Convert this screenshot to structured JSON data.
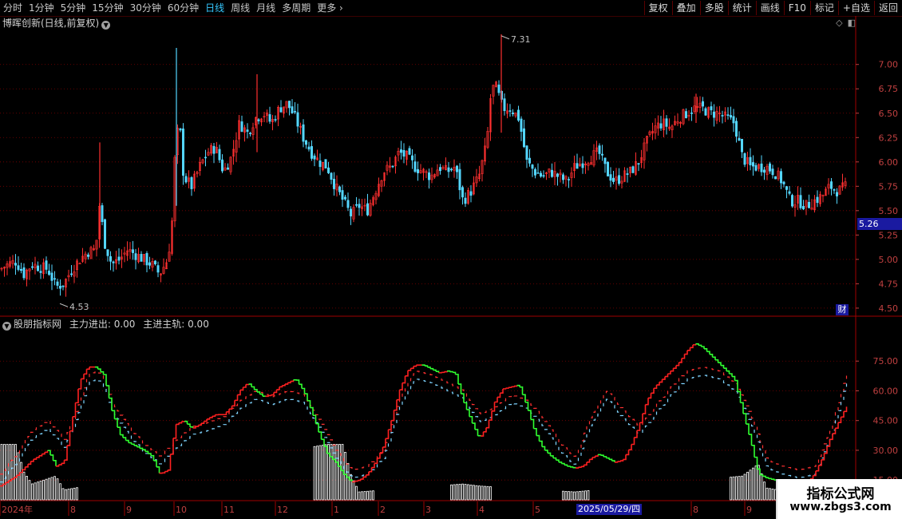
{
  "toolbar": {
    "periods": [
      "分时",
      "1分钟",
      "5分钟",
      "15分钟",
      "30分钟",
      "60分钟",
      "日线",
      "周线",
      "月线",
      "多周期",
      "更多"
    ],
    "active_period": "日线",
    "right_buttons": [
      "复权",
      "叠加",
      "多股",
      "统计",
      "画线",
      "F10",
      "标记",
      "+自选",
      "返回"
    ]
  },
  "main_panel": {
    "title": "博晖创新(日线,前复权)",
    "current_price": "5.26",
    "finance_badge": "财",
    "high_label": "7.31",
    "low_label": "4.53"
  },
  "sub_panel": {
    "title": "股朋指标网",
    "indicator1": "主力进出: 0.00",
    "indicator2": "主进主轨: 0.00"
  },
  "x_axis": {
    "labels": [
      "2024年",
      "8",
      "9",
      "10",
      "11",
      "12",
      "1",
      "2",
      "3",
      "4",
      "5",
      "2025/05/29/四",
      "8",
      "9"
    ]
  },
  "watermark": {
    "line1": "指标公式网",
    "line2": "www.zbgs3.com"
  },
  "colors": {
    "up": "#ff3030",
    "down": "#54d6ff",
    "grid": "#800000",
    "axis": "#c04040",
    "green_line": "#30ff30",
    "red_line": "#ff2020",
    "blue_line": "#7fd4ff"
  },
  "chart_data": [
    {
      "type": "candlestick",
      "title": "博晖创新(日线,前复权)",
      "y_ticks": [
        7.0,
        6.75,
        6.5,
        6.25,
        6.0,
        5.75,
        5.5,
        5.25,
        5.0,
        4.75,
        4.5
      ],
      "ylim": [
        4.45,
        7.35
      ],
      "max": 7.31,
      "min": 4.53,
      "last": 5.26,
      "approx_close_path": [
        [
          0,
          4.9
        ],
        [
          10,
          4.95
        ],
        [
          20,
          4.98
        ],
        [
          30,
          4.85
        ],
        [
          40,
          4.95
        ],
        [
          50,
          4.92
        ],
        [
          60,
          4.9
        ],
        [
          70,
          4.72
        ],
        [
          80,
          4.75
        ],
        [
          90,
          4.9
        ],
        [
          100,
          5.0
        ],
        [
          110,
          5.08
        ],
        [
          120,
          5.1
        ],
        [
          125,
          5.6
        ],
        [
          130,
          5.2
        ],
        [
          140,
          4.95
        ],
        [
          150,
          5.0
        ],
        [
          160,
          5.1
        ],
        [
          170,
          5.05
        ],
        [
          180,
          5.0
        ],
        [
          190,
          4.95
        ],
        [
          200,
          4.85
        ],
        [
          210,
          5.0
        ],
        [
          215,
          5.3
        ],
        [
          220,
          6.2
        ],
        [
          225,
          6.4
        ],
        [
          230,
          5.85
        ],
        [
          240,
          5.75
        ],
        [
          250,
          5.95
        ],
        [
          260,
          6.1
        ],
        [
          270,
          6.15
        ],
        [
          280,
          5.9
        ],
        [
          290,
          6.05
        ],
        [
          300,
          6.4
        ],
        [
          310,
          6.3
        ],
        [
          320,
          6.45
        ],
        [
          330,
          6.5
        ],
        [
          340,
          6.4
        ],
        [
          350,
          6.55
        ],
        [
          360,
          6.6
        ],
        [
          370,
          6.45
        ],
        [
          380,
          6.25
        ],
        [
          390,
          6.1
        ],
        [
          400,
          6.0
        ],
        [
          410,
          5.95
        ],
        [
          420,
          5.75
        ],
        [
          430,
          5.6
        ],
        [
          440,
          5.45
        ],
        [
          450,
          5.55
        ],
        [
          460,
          5.5
        ],
        [
          470,
          5.7
        ],
        [
          480,
          5.9
        ],
        [
          490,
          5.95
        ],
        [
          500,
          6.1
        ],
        [
          510,
          6.05
        ],
        [
          520,
          5.95
        ],
        [
          530,
          5.9
        ],
        [
          540,
          5.85
        ],
        [
          550,
          5.95
        ],
        [
          560,
          5.9
        ],
        [
          570,
          5.95
        ],
        [
          580,
          5.6
        ],
        [
          590,
          5.7
        ],
        [
          600,
          5.85
        ],
        [
          610,
          6.2
        ],
        [
          615,
          6.7
        ],
        [
          620,
          6.8
        ],
        [
          630,
          6.55
        ],
        [
          640,
          6.55
        ],
        [
          650,
          6.45
        ],
        [
          660,
          6.0
        ],
        [
          670,
          5.9
        ],
        [
          680,
          5.85
        ],
        [
          690,
          5.9
        ],
        [
          700,
          5.85
        ],
        [
          710,
          5.8
        ],
        [
          720,
          5.95
        ],
        [
          730,
          6.0
        ],
        [
          740,
          6.05
        ],
        [
          750,
          6.1
        ],
        [
          760,
          5.9
        ],
        [
          770,
          5.8
        ],
        [
          780,
          5.85
        ],
        [
          790,
          5.9
        ],
        [
          800,
          6.0
        ],
        [
          810,
          6.2
        ],
        [
          820,
          6.35
        ],
        [
          830,
          6.4
        ],
        [
          840,
          6.35
        ],
        [
          850,
          6.45
        ],
        [
          860,
          6.5
        ],
        [
          870,
          6.55
        ],
        [
          880,
          6.55
        ],
        [
          890,
          6.5
        ],
        [
          900,
          6.5
        ],
        [
          910,
          6.45
        ],
        [
          920,
          6.4
        ],
        [
          930,
          6.05
        ],
        [
          940,
          5.95
        ],
        [
          950,
          5.95
        ],
        [
          960,
          5.95
        ],
        [
          970,
          5.9
        ],
        [
          980,
          5.8
        ],
        [
          990,
          5.6
        ],
        [
          1000,
          5.6
        ],
        [
          1010,
          5.55
        ],
        [
          1020,
          5.6
        ],
        [
          1030,
          5.65
        ],
        [
          1040,
          5.75
        ],
        [
          1050,
          5.7
        ],
        [
          1060,
          5.75
        ]
      ]
    },
    {
      "type": "line",
      "title": "股朋指标网",
      "y_ticks": [
        75.0,
        60.0,
        45.0,
        30.0,
        15.0
      ],
      "ylim": [
        5,
        90
      ],
      "series": [
        {
          "name": "主力进出",
          "values_path": [
            [
              0,
              12
            ],
            [
              20,
              17
            ],
            [
              40,
              25
            ],
            [
              60,
              30
            ],
            [
              70,
              22
            ],
            [
              80,
              24
            ],
            [
              90,
              45
            ],
            [
              100,
              65
            ],
            [
              110,
              72
            ],
            [
              120,
              72
            ],
            [
              130,
              68
            ],
            [
              140,
              50
            ],
            [
              150,
              38
            ],
            [
              160,
              34
            ],
            [
              170,
              32
            ],
            [
              180,
              30
            ],
            [
              190,
              27
            ],
            [
              200,
              18
            ],
            [
              210,
              20
            ],
            [
              220,
              43
            ],
            [
              230,
              45
            ],
            [
              240,
              41
            ],
            [
              250,
              43
            ],
            [
              260,
              46
            ],
            [
              270,
              48
            ],
            [
              280,
              48
            ],
            [
              290,
              52
            ],
            [
              300,
              60
            ],
            [
              310,
              64
            ],
            [
              320,
              60
            ],
            [
              330,
              57
            ],
            [
              340,
              58
            ],
            [
              350,
              62
            ],
            [
              360,
              64
            ],
            [
              370,
              66
            ],
            [
              380,
              60
            ],
            [
              390,
              50
            ],
            [
              400,
              38
            ],
            [
              410,
              28
            ],
            [
              420,
              24
            ],
            [
              430,
              18
            ],
            [
              440,
              14
            ],
            [
              450,
              15
            ],
            [
              460,
              18
            ],
            [
              470,
              24
            ],
            [
              480,
              32
            ],
            [
              490,
              45
            ],
            [
              500,
              60
            ],
            [
              510,
              70
            ],
            [
              520,
              73
            ],
            [
              530,
              73
            ],
            [
              540,
              71
            ],
            [
              550,
              69
            ],
            [
              560,
              70
            ],
            [
              570,
              69
            ],
            [
              580,
              55
            ],
            [
              590,
              45
            ],
            [
              600,
              36
            ],
            [
              610,
              42
            ],
            [
              620,
              55
            ],
            [
              630,
              61
            ],
            [
              640,
              62
            ],
            [
              650,
              63
            ],
            [
              660,
              52
            ],
            [
              670,
              39
            ],
            [
              680,
              31
            ],
            [
              690,
              27
            ],
            [
              700,
              24
            ],
            [
              710,
              22
            ],
            [
              720,
              21
            ],
            [
              730,
              22
            ],
            [
              740,
              26
            ],
            [
              750,
              28
            ],
            [
              760,
              26
            ],
            [
              770,
              24
            ],
            [
              780,
              25
            ],
            [
              790,
              32
            ],
            [
              800,
              42
            ],
            [
              810,
              55
            ],
            [
              820,
              62
            ],
            [
              830,
              66
            ],
            [
              840,
              70
            ],
            [
              850,
              74
            ],
            [
              860,
              80
            ],
            [
              870,
              84
            ],
            [
              880,
              82
            ],
            [
              890,
              78
            ],
            [
              900,
              74
            ],
            [
              910,
              70
            ],
            [
              920,
              66
            ],
            [
              930,
              50
            ],
            [
              940,
              35
            ],
            [
              950,
              18
            ],
            [
              960,
              16
            ],
            [
              970,
              15
            ],
            [
              980,
              14
            ],
            [
              990,
              13
            ],
            [
              1000,
              12
            ],
            [
              1010,
              13
            ],
            [
              1020,
              18
            ],
            [
              1030,
              26
            ],
            [
              1040,
              36
            ],
            [
              1050,
              44
            ],
            [
              1060,
              52
            ]
          ]
        },
        {
          "name": "主进主轨",
          "values_path": [
            [
              0,
              18
            ],
            [
              20,
              28
            ],
            [
              40,
              40
            ],
            [
              60,
              45
            ],
            [
              70,
              40
            ],
            [
              80,
              35
            ],
            [
              100,
              55
            ],
            [
              110,
              68
            ],
            [
              120,
              70
            ],
            [
              130,
              66
            ],
            [
              140,
              54
            ],
            [
              160,
              42
            ],
            [
              180,
              33
            ],
            [
              200,
              27
            ],
            [
              220,
              35
            ],
            [
              240,
              42
            ],
            [
              260,
              44
            ],
            [
              280,
              47
            ],
            [
              300,
              55
            ],
            [
              320,
              60
            ],
            [
              340,
              57
            ],
            [
              360,
              60
            ],
            [
              380,
              58
            ],
            [
              400,
              45
            ],
            [
              420,
              30
            ],
            [
              440,
              20
            ],
            [
              460,
              22
            ],
            [
              480,
              30
            ],
            [
              500,
              56
            ],
            [
              520,
              70
            ],
            [
              540,
              68
            ],
            [
              560,
              64
            ],
            [
              580,
              60
            ],
            [
              600,
              48
            ],
            [
              620,
              52
            ],
            [
              640,
              58
            ],
            [
              660,
              55
            ],
            [
              680,
              46
            ],
            [
              700,
              34
            ],
            [
              720,
              26
            ],
            [
              740,
              48
            ],
            [
              760,
              60
            ],
            [
              780,
              50
            ],
            [
              800,
              42
            ],
            [
              820,
              52
            ],
            [
              840,
              62
            ],
            [
              860,
              70
            ],
            [
              880,
              72
            ],
            [
              900,
              70
            ],
            [
              920,
              64
            ],
            [
              940,
              48
            ],
            [
              960,
              25
            ],
            [
              980,
              22
            ],
            [
              1000,
              20
            ],
            [
              1020,
              22
            ],
            [
              1040,
              40
            ],
            [
              1060,
              68
            ]
          ]
        }
      ],
      "histogram_path": [
        [
          0,
          28
        ],
        [
          20,
          28
        ],
        [
          30,
          14
        ],
        [
          40,
          8
        ],
        [
          70,
          12
        ],
        [
          80,
          5
        ],
        [
          410,
          28
        ],
        [
          420,
          28
        ],
        [
          430,
          28
        ],
        [
          440,
          12
        ],
        [
          450,
          4
        ],
        [
          580,
          8
        ],
        [
          600,
          7
        ],
        [
          720,
          4
        ],
        [
          930,
          12
        ],
        [
          950,
          18
        ],
        [
          960,
          6
        ],
        [
          990,
          4
        ]
      ]
    }
  ]
}
